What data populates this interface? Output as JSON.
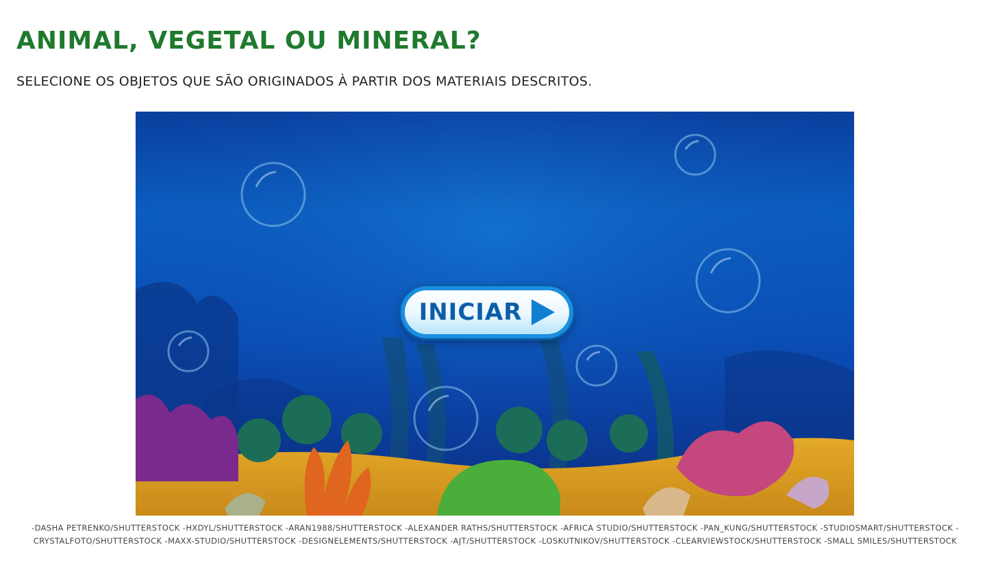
{
  "page": {
    "title": "ANIMAL, VEGETAL OU MINERAL?",
    "instructions": "SELECIONE OS OBJETOS QUE SÃO ORIGINADOS À PARTIR DOS MATERIAIS DESCRITOS."
  },
  "game": {
    "start_button_label": "INICIAR",
    "start_button_icon": "play-arrow-icon"
  },
  "credits": {
    "text": "-DASHA PETRENKO/SHUTTERSTOCK -HXDYL/SHUTTERSTOCK -ARAN1988/SHUTTERSTOCK -ALEXANDER RATHS/SHUTTERSTOCK -AFRICA STUDIO/SHUTTERSTOCK -PAN_KUNG/SHUTTERSTOCK -STUDIOSMART/SHUTTERSTOCK -CRYSTALFOTO/SHUTTERSTOCK -MAXX-STUDIO/SHUTTERSTOCK -DESIGNELEMENTS/SHUTTERSTOCK -AJT/SHUTTERSTOCK -LOSKUTNIKOV/SHUTTERSTOCK -CLEARVIEWSTOCK/SHUTTERSTOCK -SMALL SMILES/SHUTTERSTOCK"
  },
  "colors": {
    "title_green": "#1f7a2e",
    "ocean_blue": "#0b5fc2",
    "button_blue": "#0d5ea8"
  }
}
